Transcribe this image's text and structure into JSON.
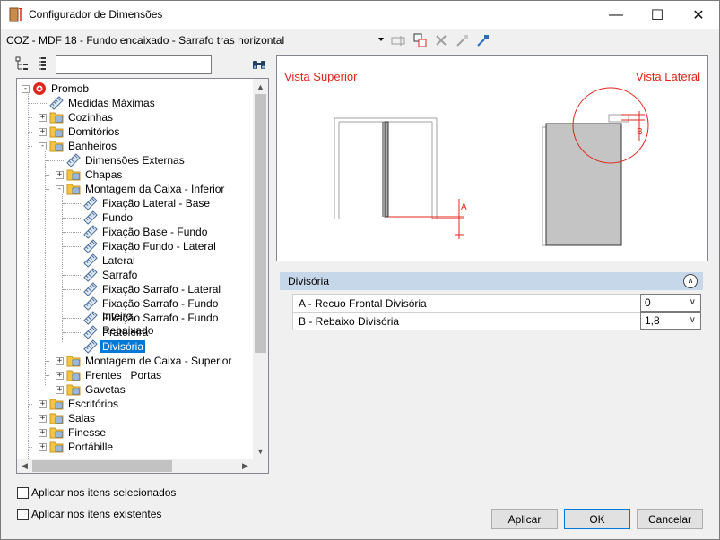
{
  "window": {
    "title": "Configurador de Dimensões"
  },
  "toolbar": {
    "combo_value": "COZ - MDF 18 - Fundo encaixado - Sarrafo tras horizontal"
  },
  "tree": {
    "items": [
      {
        "label": "Promob"
      },
      {
        "label": "Medidas Máximas"
      },
      {
        "label": "Cozinhas"
      },
      {
        "label": "Domitórios"
      },
      {
        "label": "Banheiros"
      },
      {
        "label": "Dimensões Externas"
      },
      {
        "label": "Chapas"
      },
      {
        "label": "Montagem da Caixa - Inferior"
      },
      {
        "label": "Fixação Lateral - Base"
      },
      {
        "label": "Fundo"
      },
      {
        "label": "Fixação Base - Fundo"
      },
      {
        "label": "Fixação Fundo - Lateral"
      },
      {
        "label": "Lateral"
      },
      {
        "label": "Sarrafo"
      },
      {
        "label": "Fixação Sarrafo - Lateral"
      },
      {
        "label": "Fixação Sarrafo - Fundo Inteiro"
      },
      {
        "label": "Fixação Sarrafo - Fundo Rebaixado"
      },
      {
        "label": "Prateleira"
      },
      {
        "label": "Divisória"
      },
      {
        "label": "Montagem de Caixa - Superior"
      },
      {
        "label": "Frentes | Portas"
      },
      {
        "label": "Gavetas"
      },
      {
        "label": "Escritórios"
      },
      {
        "label": "Salas"
      },
      {
        "label": "Finesse"
      },
      {
        "label": "Portábille"
      }
    ],
    "selected": "Divisória"
  },
  "preview": {
    "top_view_label": "Vista Superior",
    "side_view_label": "Vista Lateral",
    "marker_a": "A",
    "marker_b": "B"
  },
  "properties": {
    "group_title": "Divisória",
    "rows": [
      {
        "label": "A - Recuo Frontal Divisória",
        "value": "0"
      },
      {
        "label": "B - Rebaixo Divisória",
        "value": "1,8"
      }
    ]
  },
  "options": {
    "apply_selected": "Aplicar nos itens selecionados",
    "apply_existing": "Aplicar nos itens existentes"
  },
  "buttons": {
    "apply": "Aplicar",
    "ok": "OK",
    "cancel": "Cancelar"
  },
  "colors": {
    "accent": "#e0261b",
    "selection": "#0078d7",
    "group_header": "#c7d7ea"
  }
}
